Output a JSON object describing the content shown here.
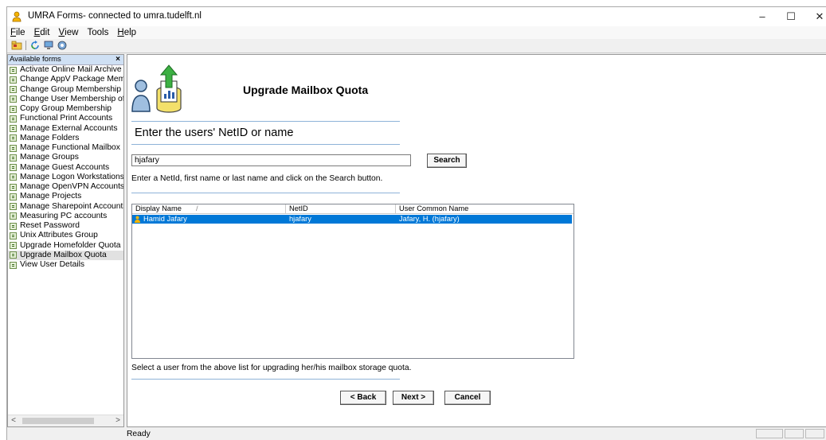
{
  "window": {
    "title": "UMRA Forms- connected to umra.tudelft.nl",
    "controls": {
      "minimize": "–",
      "maximize": "☐",
      "close": "✕"
    }
  },
  "menu": [
    {
      "accel": "F",
      "rest": "ile"
    },
    {
      "accel": "E",
      "rest": "dit"
    },
    {
      "accel": "V",
      "rest": "iew"
    },
    {
      "accel": "",
      "rest": "Tools"
    },
    {
      "accel": "H",
      "rest": "elp"
    }
  ],
  "toolbar": {
    "icons": [
      "open-icon",
      "refresh-icon",
      "computer-icon",
      "settings-icon"
    ]
  },
  "sidebar": {
    "header": "Available forms",
    "close_glyph": "×",
    "items": [
      "Activate Online Mail Archive",
      "Change AppV Package Membe",
      "Change Group Membership",
      "Change User Membership of Gr",
      "Copy Group Membership",
      "Functional Print Accounts",
      "Manage External Accounts",
      "Manage Folders",
      "Manage Functional Mailbox",
      "Manage Groups",
      "Manage Guest Accounts",
      "Manage Logon Workstations",
      "Manage OpenVPN Accounts",
      "Manage Projects",
      "Manage Sharepoint Accounts",
      "Measuring PC accounts",
      "Reset Password",
      "Unix Attributes Group",
      "Upgrade Homefolder Quota",
      "Upgrade Mailbox Quota",
      "View User Details"
    ],
    "selected_index": 19,
    "scroll_left": "<",
    "scroll_right": ">"
  },
  "form": {
    "title": "Upgrade Mailbox Quota",
    "heading": "Enter the users' NetID or name",
    "search_value": "hjafary",
    "search_button": "Search",
    "hint": "Enter a NetId, first name or last name and click on the Search button.",
    "columns": [
      "Display Name",
      "NetID",
      "User Common Name"
    ],
    "sort_glyph": "/",
    "rows": [
      {
        "display_name": "Hamid Jafary",
        "netid": "hjafary",
        "common_name": "Jafary, H. (hjafary)"
      }
    ],
    "select_hint": "Select a user from the above list for upgrading her/his mailbox storage quota.",
    "back_button": "< Back",
    "next_button": "Next >",
    "cancel_button": "Cancel"
  },
  "status": {
    "text": "Ready"
  }
}
